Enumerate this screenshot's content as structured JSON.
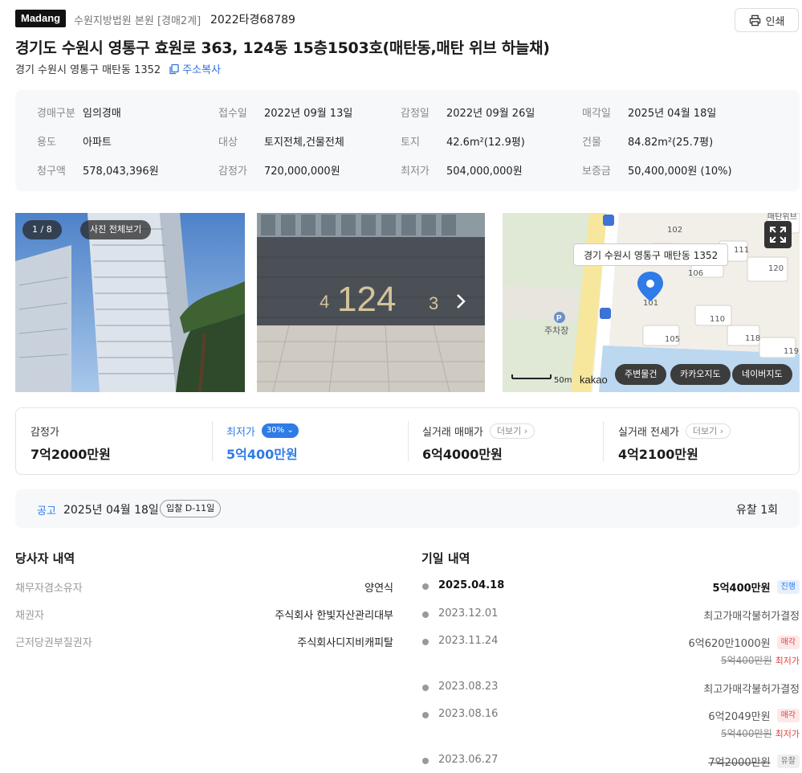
{
  "header": {
    "logo": "Madang",
    "court": "수원지방법원 본원 [경매2계]",
    "case_no": "2022타경68789",
    "print_label": "인쇄"
  },
  "title": "경기도 수원시 영통구 효원로 363, 124동 15층1503호(매탄동,매탄 위브 하늘채)",
  "address": "경기 수원시 영통구 매탄동 1352",
  "copy_label": "주소복사",
  "info": [
    {
      "k": "경매구분",
      "v": "임의경매"
    },
    {
      "k": "접수일",
      "v": "2022년 09월 13일"
    },
    {
      "k": "감정일",
      "v": "2022년 09월 26일"
    },
    {
      "k": "매각일",
      "v": "2025년 04월 18일"
    },
    {
      "k": "용도",
      "v": "아파트"
    },
    {
      "k": "대상",
      "v": "토지전체,건물전체"
    },
    {
      "k": "토지",
      "v": "42.6m²(12.9평)"
    },
    {
      "k": "건물",
      "v": "84.82m²(25.7평)"
    },
    {
      "k": "청구액",
      "v": "578,043,396원"
    },
    {
      "k": "감정가",
      "v": "720,000,000원"
    },
    {
      "k": "최저가",
      "v": "504,000,000원"
    },
    {
      "k": "보증금",
      "v": "50,400,000원 (10%)"
    }
  ],
  "photos": {
    "counter": "1 / 8",
    "view_all": "사진 전체보기",
    "plate_number": "124",
    "plate_left": "4",
    "plate_right": "3"
  },
  "map": {
    "bubble": "경기 수원시 영통구 매탄동 1352",
    "chips": [
      "주변물건",
      "카카오지도",
      "네이버지도"
    ],
    "scale": "50m",
    "brand": "kakao",
    "parking": "주차장",
    "top_right_label": "매탄위브",
    "buildings": [
      "102",
      "106",
      "101",
      "111",
      "120",
      "110",
      "105",
      "118",
      "119"
    ]
  },
  "prices": {
    "appraisal_label": "감정가",
    "appraisal_value": "7억2000만원",
    "minimum_label": "최저가",
    "minimum_pct": "30%",
    "minimum_value": "5억400만원",
    "sale_label": "실거래 매매가",
    "sale_value": "6억4000만원",
    "lease_label": "실거래 전세가",
    "lease_value": "4억2100만원",
    "more_label": "더보기"
  },
  "notice": {
    "label": "공고",
    "date": "2025년 04월 18일",
    "badge": "입찰 D-11일",
    "fail_count": "유찰 1회"
  },
  "parties": {
    "title": "당사자 내역",
    "rows": [
      {
        "k": "채무자겸소유자",
        "v": "양연식"
      },
      {
        "k": "채권자",
        "v": "주식회사 한빛자산관리대부"
      },
      {
        "k": "근저당권부질권자",
        "v": "주식회사디지비캐피탈"
      }
    ]
  },
  "timeline": {
    "title": "기일 내역",
    "rows": [
      {
        "date": "2025.04.18",
        "result": "5억400만원",
        "tag": "진행"
      },
      {
        "date": "2023.12.01",
        "result": "최고가매각불허가결정"
      },
      {
        "date": "2023.11.24",
        "result": "6억620만1000원",
        "tag": "매각",
        "sub": "5억400만원",
        "sub_tag": "최저가"
      },
      {
        "date": "2023.08.23",
        "result": "최고가매각불허가결정"
      },
      {
        "date": "2023.08.16",
        "result": "6억2049만원",
        "tag": "매각",
        "sub": "5억400만원",
        "sub_tag": "최저가"
      },
      {
        "date": "2023.06.27",
        "result": "7억2000만원",
        "tag": "유찰"
      }
    ]
  },
  "colors": {
    "accent": "#2f7be8",
    "sold": "#e04545"
  }
}
